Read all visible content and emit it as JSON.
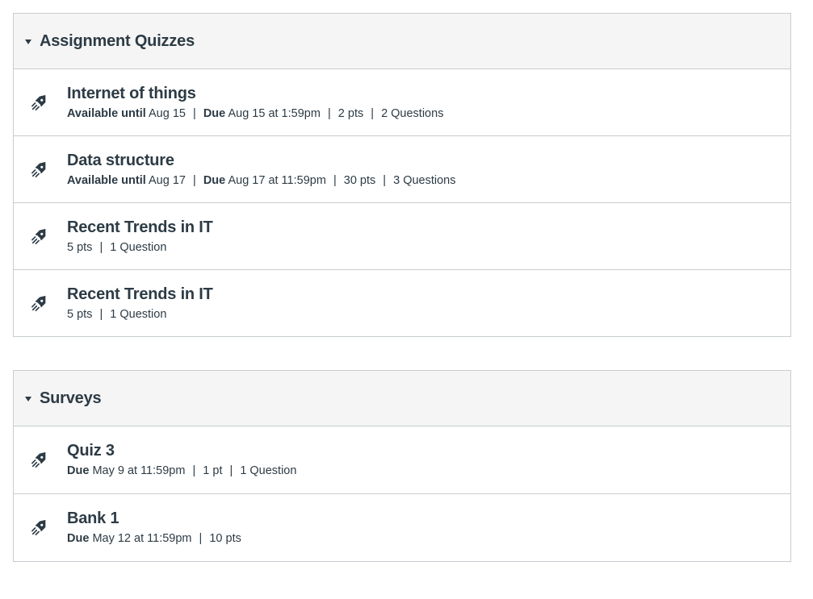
{
  "groups": [
    {
      "title": "Assignment Quizzes",
      "items": [
        {
          "title": "Internet of things",
          "available_label": "Available until",
          "available_value": "Aug 15",
          "due_label": "Due",
          "due_value": "Aug 15 at 1:59pm",
          "points": "2 pts",
          "questions": "2 Questions"
        },
        {
          "title": "Data structure",
          "available_label": "Available until",
          "available_value": "Aug 17",
          "due_label": "Due",
          "due_value": "Aug 17 at 11:59pm",
          "points": "30 pts",
          "questions": "3 Questions"
        },
        {
          "title": "Recent Trends in IT",
          "points": "5 pts",
          "questions": "1 Question"
        },
        {
          "title": "Recent Trends in IT",
          "points": "5 pts",
          "questions": "1 Question"
        }
      ]
    },
    {
      "title": "Surveys",
      "items": [
        {
          "title": "Quiz 3",
          "due_label": "Due",
          "due_value": "May 9 at 11:59pm",
          "points": "1 pt",
          "questions": "1 Question"
        },
        {
          "title": "Bank 1",
          "due_label": "Due",
          "due_value": "May 12 at 11:59pm",
          "points": "10 pts"
        }
      ]
    }
  ],
  "separator": "|",
  "icons": {
    "group_toggle": "caret-down-icon",
    "item": "quiz-rocket-icon"
  },
  "colors": {
    "text": "#2d3b45",
    "header_bg": "#f5f5f5",
    "border": "#c7cdd1"
  }
}
